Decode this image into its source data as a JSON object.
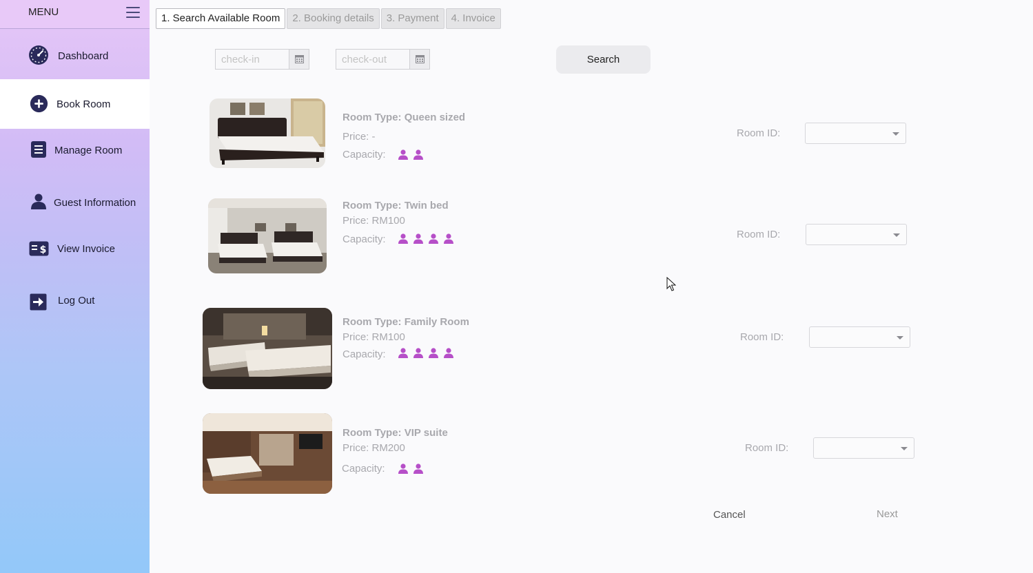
{
  "sidebar": {
    "menu_label": "MENU",
    "items": [
      {
        "label": "Dashboard",
        "icon": "dashboard-gauge-icon"
      },
      {
        "label": "Book Room",
        "icon": "plus-circle-icon"
      },
      {
        "label": "Manage Room",
        "icon": "list-document-icon"
      },
      {
        "label": "Guest Information",
        "icon": "person-icon"
      },
      {
        "label": "View Invoice",
        "icon": "invoice-dollar-icon"
      },
      {
        "label": "Log Out",
        "icon": "logout-arrow-icon"
      }
    ],
    "active_item": "Book Room"
  },
  "tabs": [
    {
      "label": "1.  Search Available Room",
      "active": true
    },
    {
      "label": "2. Booking details",
      "active": false
    },
    {
      "label": "3. Payment",
      "active": false
    },
    {
      "label": "4. Invoice",
      "active": false
    }
  ],
  "search": {
    "checkin_placeholder": "check-in",
    "checkout_placeholder": "check-out",
    "button_label": "Search"
  },
  "rooms": [
    {
      "type_label": "Room Type: Queen sized",
      "price_label": "Price: -",
      "capacity_label": "Capacity:",
      "capacity": 2,
      "room_id_label": "Room ID:",
      "room_id_value": ""
    },
    {
      "type_label": "Room Type: Twin bed",
      "price_label": "Price: RM100",
      "capacity_label": "Capacity:",
      "capacity": 4,
      "room_id_label": "Room ID:",
      "room_id_value": ""
    },
    {
      "type_label": "Room Type: Family Room",
      "price_label": "Price: RM100",
      "capacity_label": "Capacity:",
      "capacity": 4,
      "room_id_label": "Room ID:",
      "room_id_value": ""
    },
    {
      "type_label": "Room Type: VIP suite",
      "price_label": "Price: RM200",
      "capacity_label": "Capacity:",
      "capacity": 2,
      "room_id_label": "Room ID:",
      "room_id_value": ""
    }
  ],
  "actions": {
    "cancel_label": "Cancel",
    "next_label": "Next"
  },
  "colors": {
    "accent_purple": "#b64fc8",
    "icon_navy": "#2a2a5a"
  }
}
